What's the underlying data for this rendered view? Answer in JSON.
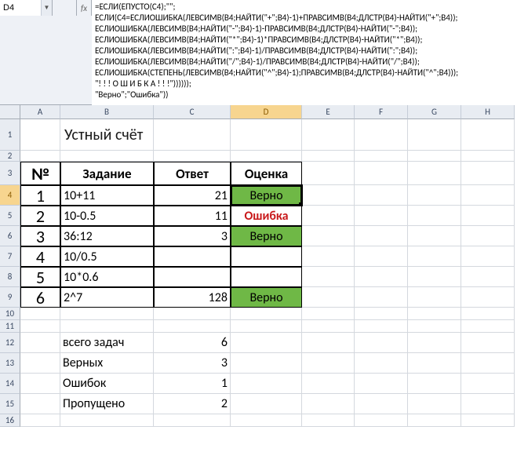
{
  "name_box": "D4",
  "fx_label": "fx",
  "formula": "=ЕСЛИ(ЕПУСТО(C4);\"\";\nЕСЛИ(C4=ЕСЛИОШИБКА(ЛЕВСИМВ(B4;НАЙТИ(\"+\";B4)-1)+ПРАВСИМВ(B4;ДЛСТР(B4)-НАЙТИ(\"+\";B4));\nЕСЛИОШИБКА(ЛЕВСИМВ(B4;НАЙТИ(\"-\";B4)-1)-ПРАВСИМВ(B4;ДЛСТР(B4)-НАЙТИ(\"-\";B4));\nЕСЛИОШИБКА(ЛЕВСИМВ(B4;НАЙТИ(\"*\";B4)-1)*ПРАВСИМВ(B4;ДЛСТР(B4)-НАЙТИ(\"*\";B4));\nЕСЛИОШИБКА(ЛЕВСИМВ(B4;НАЙТИ(\":\";B4)-1)/ПРАВСИМВ(B4;ДЛСТР(B4)-НАЙТИ(\":\";B4));\nЕСЛИОШИБКА(ЛЕВСИМВ(B4;НАЙТИ(\"/\";B4)-1)/ПРАВСИМВ(B4;ДЛСТР(B4)-НАЙТИ(\"/\";B4));\nЕСЛИОШИБКА(СТЕПЕНЬ(ЛЕВСИМВ(B4;НАЙТИ(\"^\";B4)-1);ПРАВСИМВ(B4;ДЛСТР(B4)-НАЙТИ(\"^\";B4)));\n\"! ! ! О Ш И Б К А ! ! !\"))))));\n\"Верно\";\"Ошибка\"))",
  "columns": [
    "A",
    "B",
    "C",
    "D",
    "E",
    "F",
    "G",
    "H"
  ],
  "title": "Устный счёт",
  "headers": {
    "num": "№",
    "task": "Задание",
    "answer": "Ответ",
    "grade": "Оценка"
  },
  "rows": [
    {
      "n": "1",
      "task": "10+11",
      "answer": "21",
      "grade": "Верно",
      "status": "correct"
    },
    {
      "n": "2",
      "task": "10-0.5",
      "answer": "11",
      "grade": "Ошибка",
      "status": "error"
    },
    {
      "n": "3",
      "task": "36:12",
      "answer": "3",
      "grade": "Верно",
      "status": "correct"
    },
    {
      "n": "4",
      "task": "10/0.5",
      "answer": "",
      "grade": "",
      "status": ""
    },
    {
      "n": "5",
      "task": "10*0.6",
      "answer": "",
      "grade": "",
      "status": ""
    },
    {
      "n": "6",
      "task": "2^7",
      "answer": "128",
      "grade": "Верно",
      "status": "correct"
    }
  ],
  "summary": {
    "total_label": "всего задач",
    "total": "6",
    "correct_label": "Верных",
    "correct": "3",
    "errors_label": "Ошибок",
    "errors": "1",
    "skipped_label": "Пропущено",
    "skipped": "2"
  },
  "row_numbers": [
    "1",
    "2",
    "3",
    "4",
    "5",
    "6",
    "7",
    "8",
    "9",
    "10",
    "11",
    "12",
    "13",
    "14",
    "15",
    "16"
  ]
}
